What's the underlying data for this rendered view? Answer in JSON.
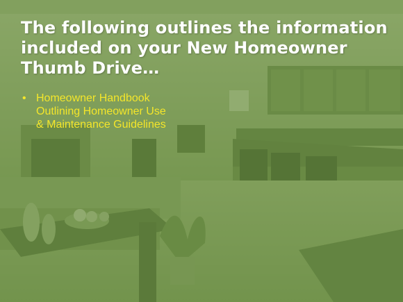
{
  "slide": {
    "title_lines": [
      "The following outlines the information",
      "included on your New Homeowner",
      "Thumb Drive…"
    ],
    "bullets": [
      {
        "lines": [
          "Homeowner Handbook",
          "Outlining Homeowner Use",
          "& Maintenance Guidelines"
        ]
      }
    ]
  },
  "colors": {
    "overlay_green": "#688c42",
    "title_text": "#ffffff",
    "bullet_text": "#f4e62a"
  }
}
